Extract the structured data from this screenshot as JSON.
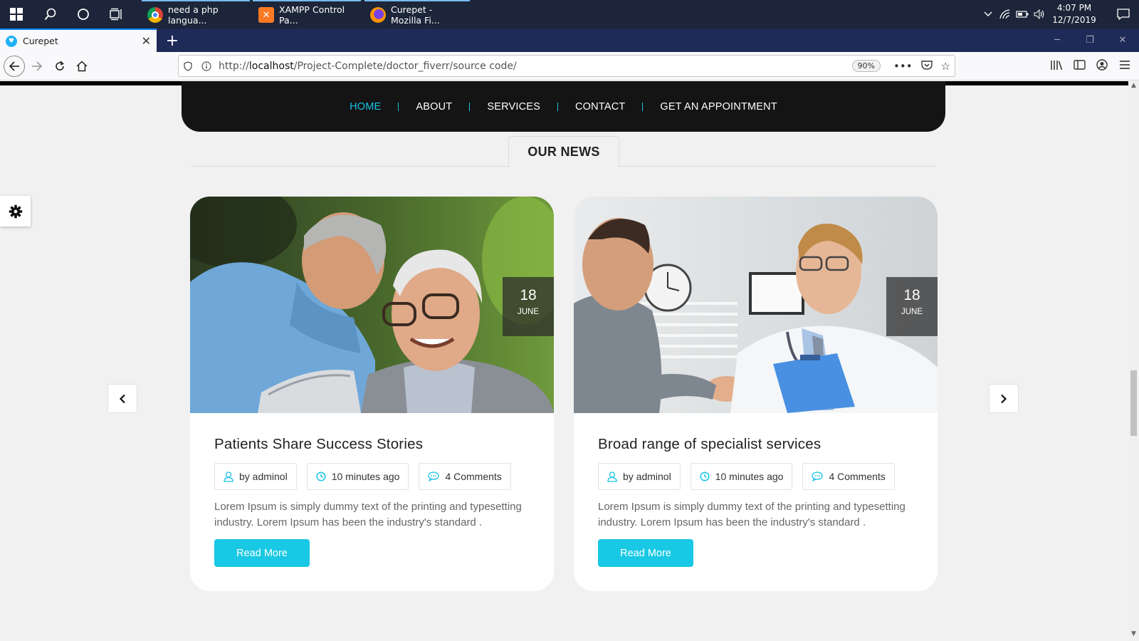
{
  "taskbar": {
    "apps": [
      {
        "label": "need a php langua...",
        "icon": "chrome-icon"
      },
      {
        "label": "XAMPP Control Pa...",
        "icon": "xampp-icon"
      },
      {
        "label": "Curepet - Mozilla Fi...",
        "icon": "firefox-icon"
      }
    ],
    "time": "4:07 PM",
    "date": "12/7/2019"
  },
  "browser": {
    "tab_title": "Curepet",
    "url_prefix": "http://",
    "url_host": "localhost",
    "url_path": "/Project-Complete/doctor_fiverr/source code/",
    "zoom": "90%"
  },
  "site": {
    "nav": [
      {
        "label": "HOME",
        "active": true
      },
      {
        "label": "ABOUT",
        "active": false
      },
      {
        "label": "SERVICES",
        "active": false
      },
      {
        "label": "CONTACT",
        "active": false
      },
      {
        "label": "GET AN APPOINTMENT",
        "active": false
      }
    ],
    "section_title": "OUR NEWS",
    "accent_color": "#19c3e6",
    "posts": [
      {
        "day": "18",
        "month": "JUNE",
        "title": "Patients Share Success Stories",
        "author": "by adminol",
        "time": "10 minutes ago",
        "comments": "4 Comments",
        "excerpt": "Lorem Ipsum is simply dummy text of the printing and typesetting industry. Lorem Ipsum has been the industry's standard .",
        "button": "Read More"
      },
      {
        "day": "18",
        "month": "JUNE",
        "title": "Broad range of specialist services",
        "author": "by adminol",
        "time": "10 minutes ago",
        "comments": "4 Comments",
        "excerpt": "Lorem Ipsum is simply dummy text of the printing and typesetting industry. Lorem Ipsum has been the industry's standard .",
        "button": "Read More"
      }
    ]
  }
}
